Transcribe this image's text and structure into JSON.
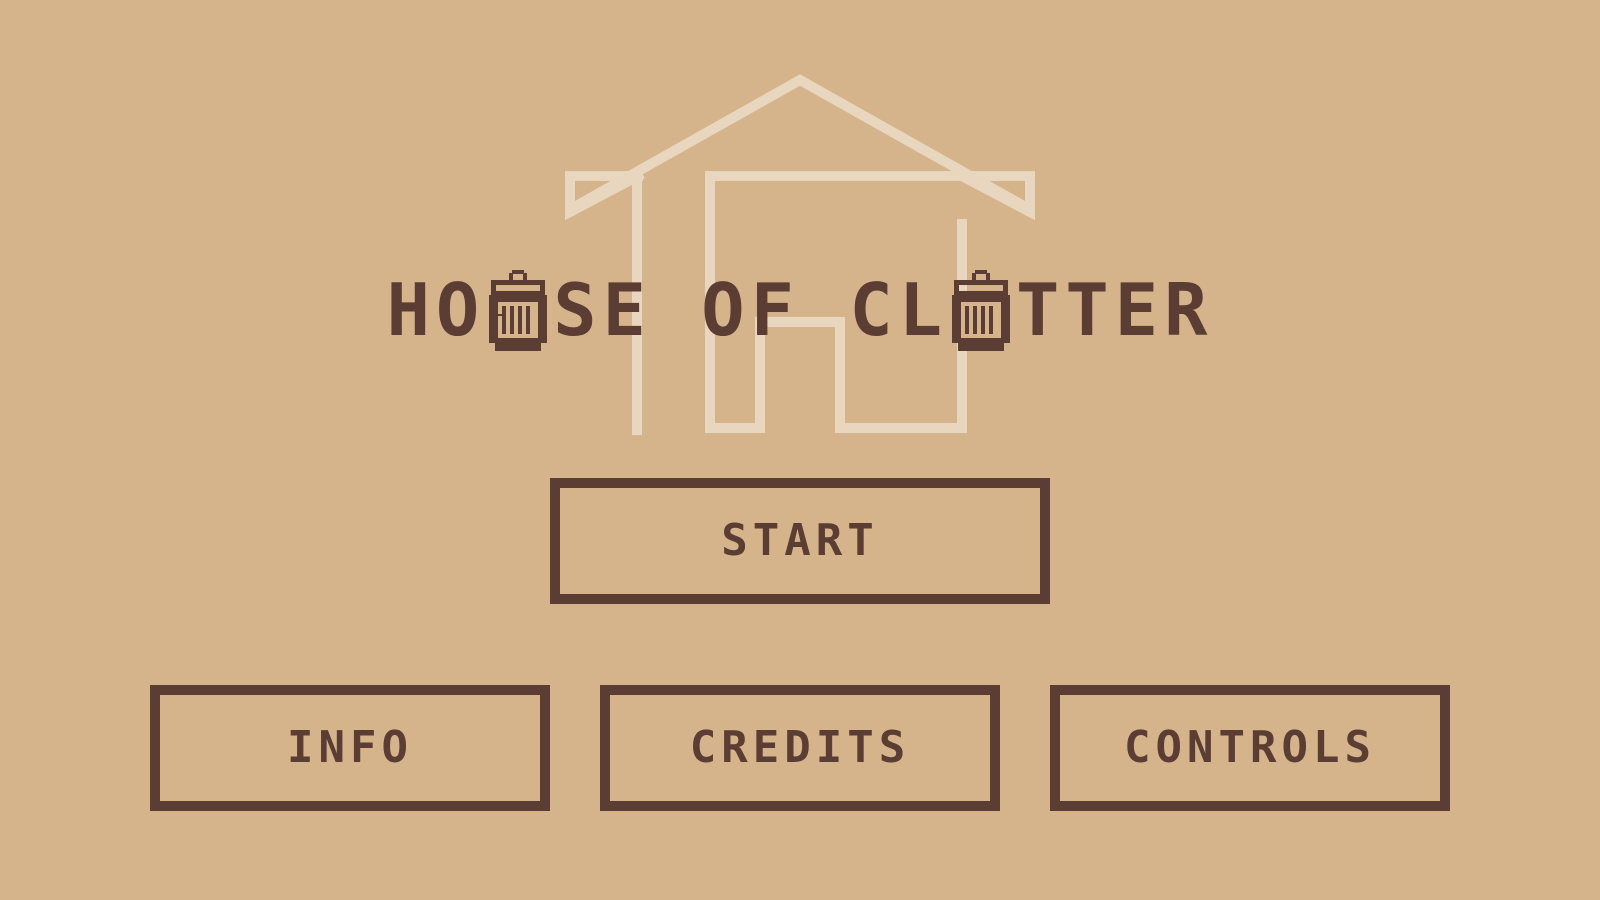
{
  "theme": {
    "background": "#d5b48c",
    "ink": "#5b3d34",
    "house_outline": "#e8d6bf"
  },
  "title": {
    "part1": "HO",
    "part2": "SE OF CL",
    "part3": "TTER",
    "letter_icon": "trash-can-icon"
  },
  "menu": {
    "start_label": "START",
    "info_label": "INFO",
    "credits_label": "CREDITS",
    "controls_label": "CONTROLS"
  }
}
